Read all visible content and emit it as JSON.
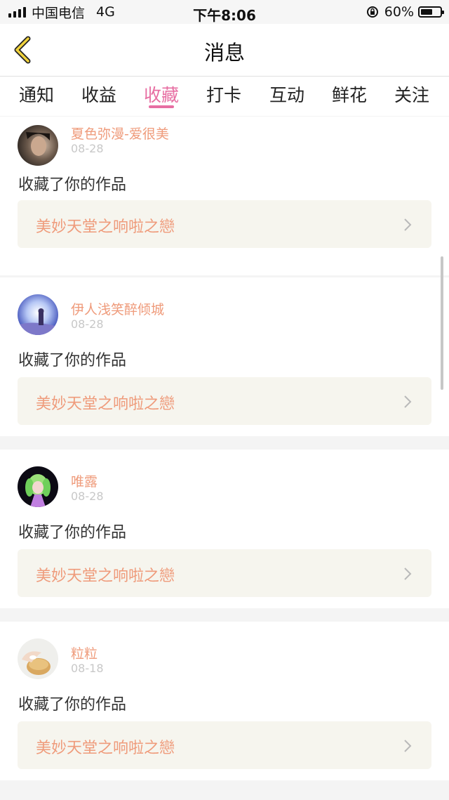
{
  "status_bar": {
    "carrier": "中国电信",
    "network": "4G",
    "time": "下午8:06",
    "battery": "60%",
    "battery_level": 0.6
  },
  "nav": {
    "title": "消息",
    "back_icon": "chevron-left-icon"
  },
  "tabs": [
    {
      "label": "通知",
      "active": false
    },
    {
      "label": "收益",
      "active": false
    },
    {
      "label": "收藏",
      "active": true
    },
    {
      "label": "打卡",
      "active": false
    },
    {
      "label": "互动",
      "active": false
    },
    {
      "label": "鲜花",
      "active": false
    },
    {
      "label": "关注",
      "active": false
    }
  ],
  "colors": {
    "accent": "#e76ea2",
    "name": "#ef9b7b",
    "work_bg": "#f6f5ee"
  },
  "messages": [
    {
      "user": "夏色弥漫-爱很美",
      "date": "08-28",
      "action": "收藏了你的作品",
      "work_title": "美妙天堂之响啦之戀"
    },
    {
      "user": "伊人浅笑醉倾城",
      "date": "08-28",
      "action": "收藏了你的作品",
      "work_title": "美妙天堂之响啦之戀"
    },
    {
      "user": "唯露",
      "date": "08-28",
      "action": "收藏了你的作品",
      "work_title": "美妙天堂之响啦之戀"
    },
    {
      "user": "粒粒",
      "date": "08-18",
      "action": "收藏了你的作品",
      "work_title": "美妙天堂之响啦之戀"
    }
  ]
}
